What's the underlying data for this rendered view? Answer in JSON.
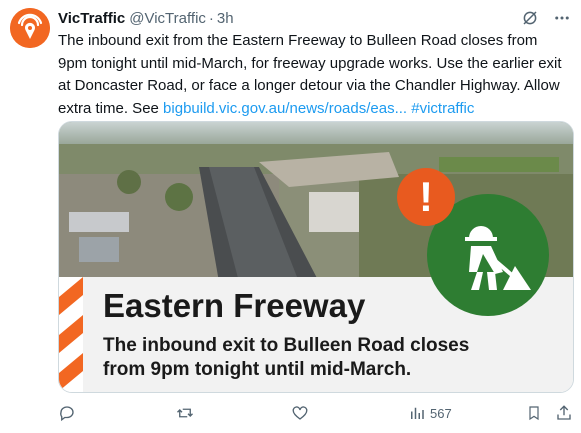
{
  "tweet": {
    "display_name": "VicTraffic",
    "handle": "@VicTraffic",
    "separator": "·",
    "time": "3h",
    "body_text": "The inbound exit from the Eastern Freeway to Bulleen Road closes from 9pm tonight until mid-March, for freeway upgrade works. Use the earlier exit at Doncaster Road, or face a longer detour via the Chandler Highway. Allow extra time. See ",
    "link_text": "bigbuild.vic.gov.au/news/roads/eas...",
    "hashtag": "#victraffic"
  },
  "card": {
    "alert_symbol": "!",
    "banner_title": "Eastern Freeway",
    "banner_subtitle": "The inbound exit to Bulleen Road closes from 9pm tonight until mid-March."
  },
  "actions": {
    "views_count": "567"
  },
  "colors": {
    "brand_orange": "#f26722",
    "link_blue": "#1d9bf0",
    "alert_orange": "#e85a1f",
    "worker_green": "#2e7d32"
  }
}
